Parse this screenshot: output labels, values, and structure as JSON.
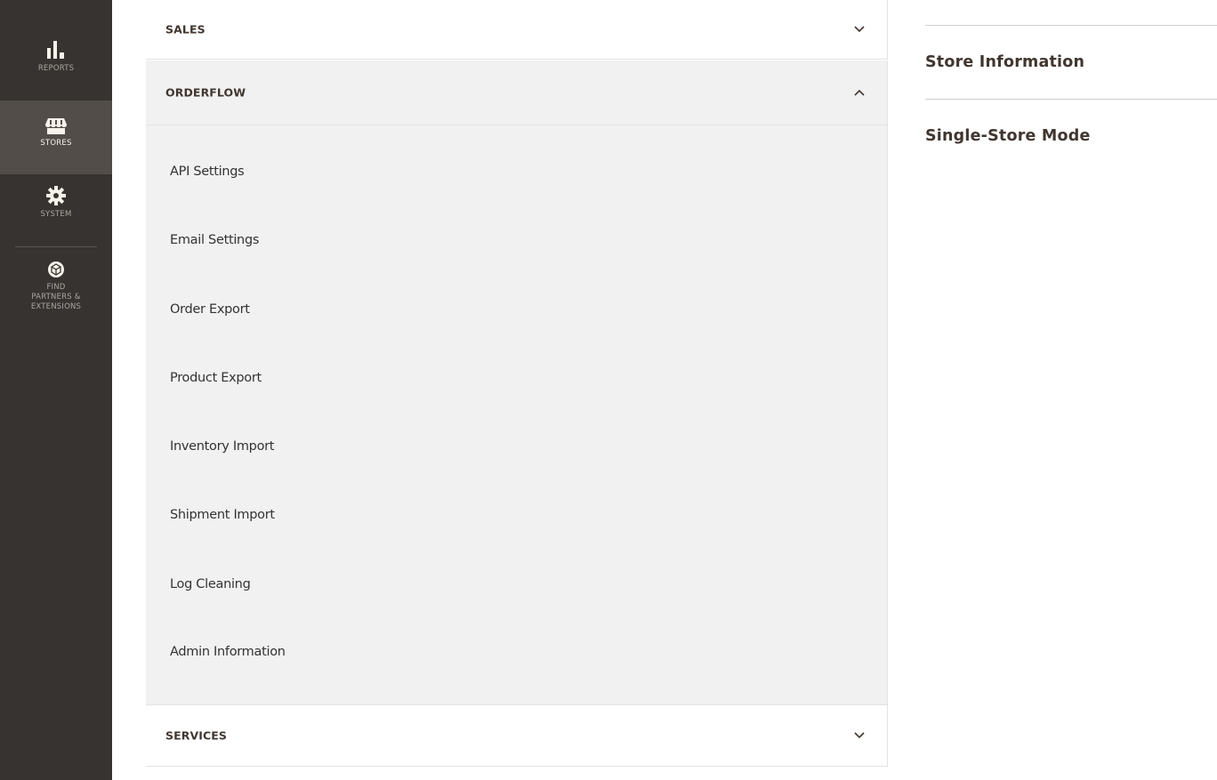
{
  "nav": {
    "items": [
      {
        "label": "REPORTS",
        "icon": "bar-chart-icon"
      },
      {
        "label": "STORES",
        "icon": "store-icon",
        "active": true
      },
      {
        "label": "SYSTEM",
        "icon": "gear-icon"
      },
      {
        "label": "FIND PARTNERS & EXTENSIONS",
        "icon": "cube-icon",
        "lines": [
          "FIND",
          "PARTNERS &",
          "EXTENSIONS"
        ]
      }
    ]
  },
  "tabs": {
    "sales": {
      "label": "SALES",
      "state": "collapsed"
    },
    "orderflow": {
      "label": "ORDERFLOW",
      "state": "expanded",
      "items": [
        "API Settings",
        "Email Settings",
        "Order Export",
        "Product Export",
        "Inventory Import",
        "Shipment Import",
        "Log Cleaning",
        "Admin Information"
      ]
    },
    "services": {
      "label": "SERVICES",
      "state": "collapsed"
    }
  },
  "content": {
    "sections": [
      "Store Information",
      "Single-Store Mode"
    ]
  },
  "colors": {
    "nav_bg": "#373330",
    "nav_active": "#524d49",
    "panel_bg": "#f1f1f1",
    "heading": "#41362f"
  }
}
